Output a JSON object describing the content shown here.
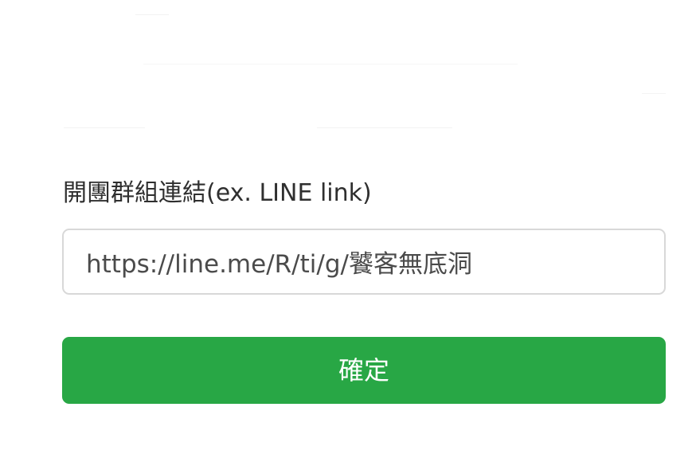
{
  "form": {
    "group_link": {
      "label": "開團群組連結(ex. LINE link)",
      "value": "https://line.me/R/ti/g/饕客無底洞"
    },
    "confirm_button": {
      "label": "確定"
    }
  },
  "colors": {
    "primary_button": "#28a745",
    "input_border": "#d8d8d8",
    "label_text": "#2f2f2f",
    "input_text": "#4b4b4b"
  }
}
